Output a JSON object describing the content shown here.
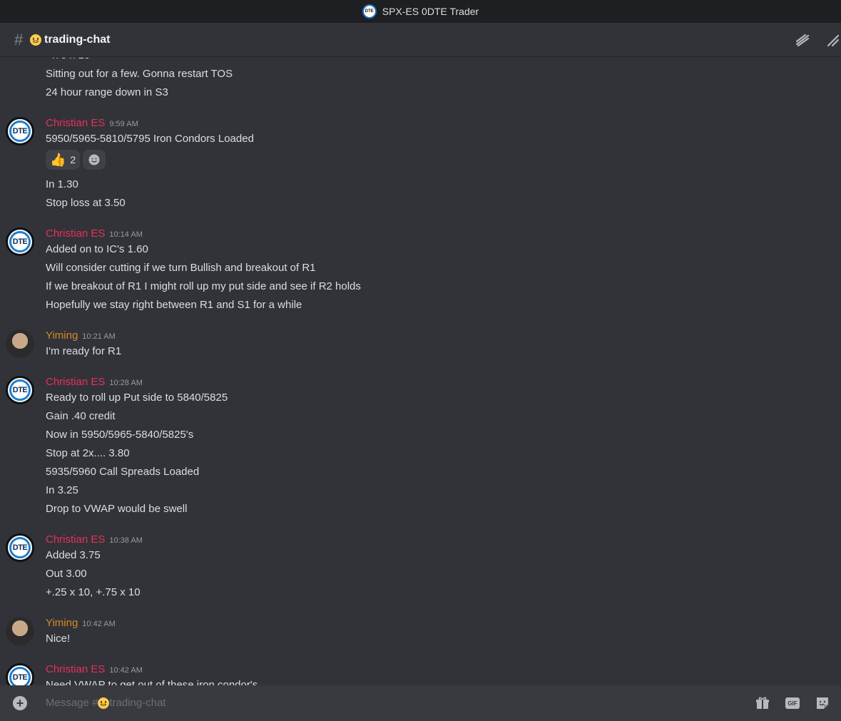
{
  "window": {
    "title": "SPX-ES 0DTE Trader",
    "logo_text": "DTE"
  },
  "channel": {
    "name": "trading-chat"
  },
  "colors": {
    "christian": "#e8305a",
    "yiming": "#d78a25",
    "timestamp": "#949ba4"
  },
  "messages": {
    "cont": [
      "Sitting out for a few. Gonna restart TOS",
      "24 hour range down in S3"
    ],
    "g1": {
      "author": "Christian ES",
      "time": "9:59 AM",
      "lines": [
        "5950/5965-5810/5795 Iron Condors Loaded",
        "In 1.30",
        "Stop loss at 3.50"
      ],
      "reaction": {
        "emoji": "thumbs-up-icon",
        "count": "2"
      }
    },
    "g2": {
      "author": "Christian ES",
      "time": "10:14 AM",
      "lines": [
        "Added on to IC's 1.60",
        "Will consider cutting if we turn Bullish and breakout of R1",
        "If we breakout of R1 I might roll up my put side and see if R2 holds",
        "Hopefully we stay right between R1 and S1 for a while"
      ]
    },
    "g3": {
      "author": "Yiming",
      "time": "10:21 AM",
      "lines": [
        "I'm ready for R1"
      ]
    },
    "g4": {
      "author": "Christian ES",
      "time": "10:28 AM",
      "lines": [
        "Ready to roll up Put side to 5840/5825",
        "Gain .40 credit",
        "Now in 5950/5965-5840/5825's",
        "Stop at 2x....  3.80",
        "5935/5960 Call Spreads Loaded",
        "In 3.25",
        "Drop to VWAP would be swell"
      ]
    },
    "g5": {
      "author": "Christian ES",
      "time": "10:38 AM",
      "lines": [
        "Added 3.75",
        "Out 3.00",
        "+.25 x 10,  +.75 x 10"
      ]
    },
    "g6": {
      "author": "Yiming",
      "time": "10:42 AM",
      "lines": [
        "Nice!"
      ]
    },
    "g7": {
      "author": "Christian ES",
      "time": "10:42 AM",
      "lines": [
        "Need VWAP to get out of these iron condor's"
      ]
    }
  },
  "composer": {
    "placeholder_prefix": "Message #",
    "placeholder_channel": "trading-chat",
    "gif_label": "GIF"
  }
}
